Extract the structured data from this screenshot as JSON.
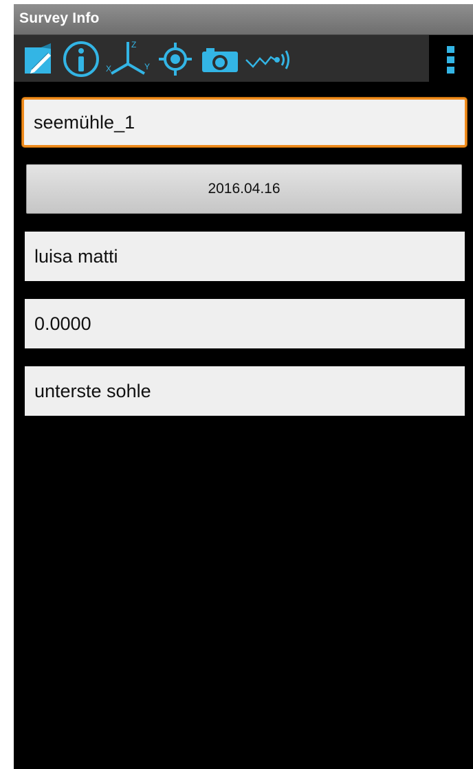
{
  "window": {
    "title": "Survey Info"
  },
  "toolbar": {
    "icons": [
      "note-edit-icon",
      "info-icon",
      "axes-xyz-icon",
      "locate-icon",
      "camera-icon",
      "sensor-icon"
    ],
    "axis_labels": {
      "x": "X",
      "y": "Y",
      "z": "Z"
    },
    "overflow_icon": "overflow-menu-icon",
    "accent_color": "#33b5e5"
  },
  "form": {
    "survey_name": "seemühle_1",
    "date": "2016.04.16",
    "team": "luisa matti",
    "declination": "0.0000",
    "comment": "unterste sohle"
  },
  "colors": {
    "focus_border": "#f08c1e",
    "background": "#000000",
    "field_background": "#efefef"
  }
}
